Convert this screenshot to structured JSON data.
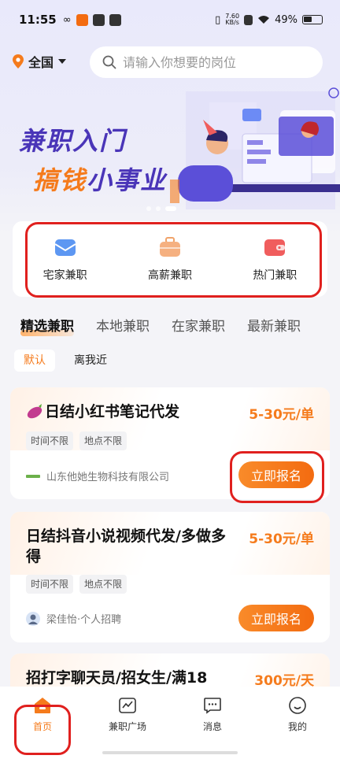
{
  "status_bar": {
    "time": "11:55",
    "net_speed_value": "7.60",
    "net_speed_unit": "KB/s",
    "battery": "49%"
  },
  "header": {
    "location": "全国",
    "search_placeholder": "请输入你想要的岗位"
  },
  "banner": {
    "line1": "兼职入门",
    "line2_part1": "搞钱",
    "line2_part2": "小事业"
  },
  "quick_links": [
    {
      "label": "宅家兼职",
      "icon": "envelope-icon"
    },
    {
      "label": "高薪兼职",
      "icon": "briefcase-icon"
    },
    {
      "label": "热门兼职",
      "icon": "wallet-icon"
    }
  ],
  "tabs": [
    "精选兼职",
    "本地兼职",
    "在家兼职",
    "最新兼职"
  ],
  "filters": [
    "默认",
    "离我近"
  ],
  "jobs": [
    {
      "title": "日结小红书笔记代发",
      "salary": "5-30元/单",
      "tags": [
        "时间不限",
        "地点不限"
      ],
      "company": "山东他她生物科技有限公司",
      "button": "立即报名"
    },
    {
      "title": "日结抖音小说视频代发/多做多得",
      "salary": "5-30元/单",
      "tags": [
        "时间不限",
        "地点不限"
      ],
      "company": "梁佳怡·个人招聘",
      "button": "立即报名"
    },
    {
      "title": "招打字聊天员/招女生/满18",
      "salary": "300元/天"
    }
  ],
  "bottom_nav": [
    {
      "label": "首页",
      "icon": "home-icon"
    },
    {
      "label": "兼职广场",
      "icon": "chart-icon"
    },
    {
      "label": "消息",
      "icon": "message-icon"
    },
    {
      "label": "我的",
      "icon": "profile-icon"
    }
  ],
  "colors": {
    "accent": "#f57b1c",
    "brand_purple": "#4a35b8",
    "highlight_box": "#e0201e"
  }
}
